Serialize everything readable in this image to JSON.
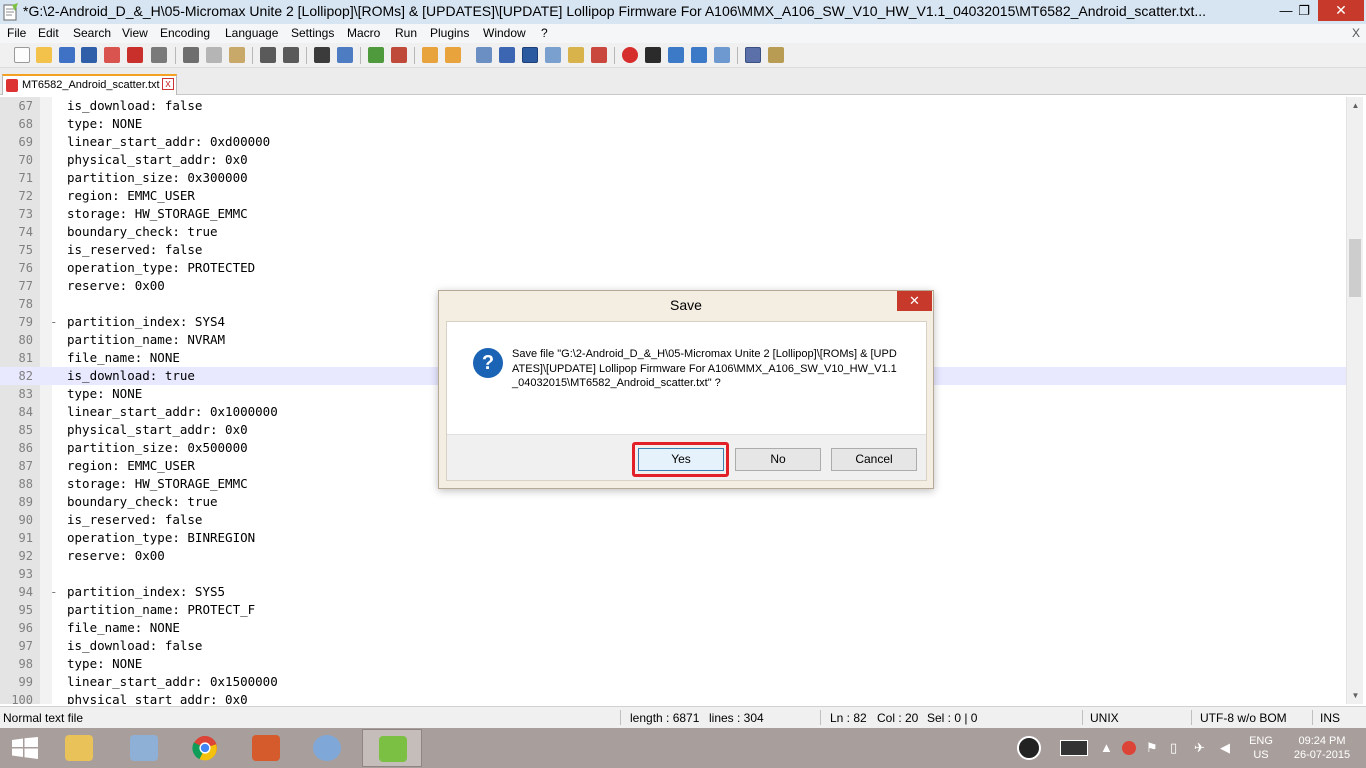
{
  "window": {
    "title": "*G:\\2-Android_D_&_H\\05-Micromax Unite 2 [Lollipop]\\[ROMs] & [UPDATES]\\[UPDATE] Lollipop Firmware For A106\\MMX_A106_SW_V10_HW_V1.1_04032015\\MT6582_Android_scatter.txt...",
    "min_glyph": "—",
    "max_glyph": "❐",
    "close_glyph": "✕"
  },
  "menu": {
    "items": [
      "File",
      "Edit",
      "Search",
      "View",
      "Encoding",
      "Language",
      "Settings",
      "Macro",
      "Run",
      "Plugins",
      "Window",
      "?"
    ],
    "close_glyph": "X"
  },
  "tab": {
    "label": "MT6582_Android_scatter.txt",
    "close_glyph": "x"
  },
  "editor": {
    "lines": [
      {
        "num": "67",
        "fold": "",
        "text": "is_download: false"
      },
      {
        "num": "68",
        "fold": "",
        "text": "type: NONE"
      },
      {
        "num": "69",
        "fold": "",
        "text": "linear_start_addr: 0xd00000"
      },
      {
        "num": "70",
        "fold": "",
        "text": "physical_start_addr: 0x0"
      },
      {
        "num": "71",
        "fold": "",
        "text": "partition_size: 0x300000"
      },
      {
        "num": "72",
        "fold": "",
        "text": "region: EMMC_USER"
      },
      {
        "num": "73",
        "fold": "",
        "text": "storage: HW_STORAGE_EMMC"
      },
      {
        "num": "74",
        "fold": "",
        "text": "boundary_check: true"
      },
      {
        "num": "75",
        "fold": "",
        "text": "is_reserved: false"
      },
      {
        "num": "76",
        "fold": "",
        "text": "operation_type: PROTECTED"
      },
      {
        "num": "77",
        "fold": "",
        "text": "reserve: 0x00"
      },
      {
        "num": "78",
        "fold": "",
        "text": ""
      },
      {
        "num": "79",
        "fold": "-",
        "text": "partition_index: SYS4"
      },
      {
        "num": "80",
        "fold": "",
        "text": "partition_name: NVRAM"
      },
      {
        "num": "81",
        "fold": "",
        "text": "file_name: NONE"
      },
      {
        "num": "82",
        "fold": "",
        "text": "is_download: true"
      },
      {
        "num": "83",
        "fold": "",
        "text": "type: NONE"
      },
      {
        "num": "84",
        "fold": "",
        "text": "linear_start_addr: 0x1000000"
      },
      {
        "num": "85",
        "fold": "",
        "text": "physical_start_addr: 0x0"
      },
      {
        "num": "86",
        "fold": "",
        "text": "partition_size: 0x500000"
      },
      {
        "num": "87",
        "fold": "",
        "text": "region: EMMC_USER"
      },
      {
        "num": "88",
        "fold": "",
        "text": "storage: HW_STORAGE_EMMC"
      },
      {
        "num": "89",
        "fold": "",
        "text": "boundary_check: true"
      },
      {
        "num": "90",
        "fold": "",
        "text": "is_reserved: false"
      },
      {
        "num": "91",
        "fold": "",
        "text": "operation_type: BINREGION"
      },
      {
        "num": "92",
        "fold": "",
        "text": "reserve: 0x00"
      },
      {
        "num": "93",
        "fold": "",
        "text": ""
      },
      {
        "num": "94",
        "fold": "-",
        "text": "partition_index: SYS5"
      },
      {
        "num": "95",
        "fold": "",
        "text": "partition_name: PROTECT_F"
      },
      {
        "num": "96",
        "fold": "",
        "text": "file_name: NONE"
      },
      {
        "num": "97",
        "fold": "",
        "text": "is_download: false"
      },
      {
        "num": "98",
        "fold": "",
        "text": "type: NONE"
      },
      {
        "num": "99",
        "fold": "",
        "text": "linear_start_addr: 0x1500000"
      },
      {
        "num": "100",
        "fold": "",
        "text": "physical_start_addr: 0x0"
      }
    ],
    "current_line": "82"
  },
  "statusbar": {
    "file_type": "Normal text file",
    "length": "length : 6871",
    "lines": "lines : 304",
    "ln": "Ln : 82",
    "col": "Col : 20",
    "sel": "Sel : 0 | 0",
    "eol": "UNIX",
    "encoding": "UTF-8 w/o BOM",
    "mode": "INS"
  },
  "dialog": {
    "title": "Save",
    "close_glyph": "✕",
    "icon_glyph": "?",
    "message": "Save file \"G:\\2-Android_D_&_H\\05-Micromax Unite 2 [Lollipop]\\[ROMs] & [UPDATES]\\[UPDATE] Lollipop Firmware For A106\\MMX_A106_SW_V10_HW_V1.1_04032015\\MT6582_Android_scatter.txt\" ?",
    "buttons": {
      "yes": "Yes",
      "no": "No",
      "cancel": "Cancel"
    }
  },
  "taskbar": {
    "lang_top": "ENG",
    "lang_bottom": "US",
    "time": "09:24 PM",
    "date": "26-07-2015"
  }
}
